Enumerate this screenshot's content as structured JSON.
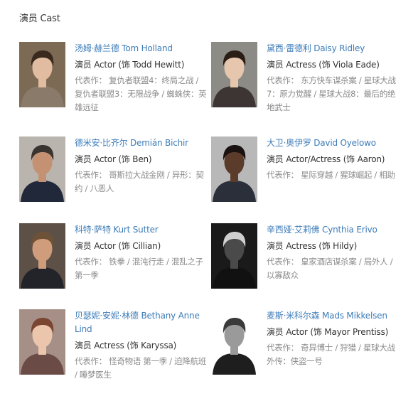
{
  "section": {
    "title": "演员 Cast"
  },
  "cast": [
    {
      "name": "汤姆·赫兰德 Tom Holland",
      "role": "演员 Actor (饰 Todd Hewitt)",
      "works_prefix": "代表作：",
      "works": "复仇者联盟4：终局之战 / 复仇者联盟3：无限战争 / 蜘蛛侠：英雄远征",
      "photo": {
        "bg": "#7d6a55",
        "skin": "#e2bca0",
        "hair": "#3a2a1e",
        "shirt": "#8a7a6a"
      }
    },
    {
      "name": "黛西·雷德利 Daisy Ridley",
      "role": "演员 Actress (饰 Viola Eade)",
      "works_prefix": "代表作：",
      "works": "东方快车谋杀案 / 星球大战7：原力觉醒 / 星球大战8：最后的绝地武士",
      "photo": {
        "bg": "#8c8b86",
        "skin": "#e6c6ad",
        "hair": "#2a1d16",
        "shirt": "#3c3533"
      }
    },
    {
      "name": "德米安·比齐尔 Demián Bichir",
      "role": "演员 Actor (饰 Ben)",
      "works_prefix": "代表作：",
      "works": "哥斯拉大战金刚 / 异形：契约 / 八恶人",
      "photo": {
        "bg": "#b9b4ad",
        "skin": "#c49272",
        "hair": "#3a3430",
        "shirt": "#20283a"
      }
    },
    {
      "name": "大卫·奥伊罗 David Oyelowo",
      "role": "演员 Actor/Actress (饰 Aaron)",
      "works_prefix": "代表作：",
      "works": "星际穿越 / 猩球崛起 / 相助",
      "photo": {
        "bg": "#b8b8b8",
        "skin": "#5b3b2a",
        "hair": "#1a1210",
        "shirt": "#2a2f3a"
      }
    },
    {
      "name": "科特·萨特 Kurt Sutter",
      "role": "演员 Actor (饰 Cillian)",
      "works_prefix": "代表作：",
      "works": "铁拳 / 混沌行走 / 混乱之子 第一季",
      "photo": {
        "bg": "#5d5046",
        "skin": "#cf9d7c",
        "hair": "#6e5238",
        "shirt": "#23242a"
      }
    },
    {
      "name": "辛西娅·艾莉佛 Cynthia Erivo",
      "role": "演员 Actress (饰 Hildy)",
      "works_prefix": "代表作：",
      "works": "皇家酒店谋杀案 / 局外人 / 以寡敌众",
      "photo": {
        "bg": "#1a1a1a",
        "skin": "#4a4a4a",
        "hair": "#cfcfcf",
        "shirt": "#111111"
      }
    },
    {
      "name": "贝瑟妮·安妮·林德 Bethany Anne Lind",
      "role": "演员 Actress (饰 Karyssa)",
      "works_prefix": "代表作：",
      "works": "怪奇物语 第一季 / 迫降航班 / 睡梦医生",
      "photo": {
        "bg": "#a58f86",
        "skin": "#ebc6ad",
        "hair": "#7a4632",
        "shirt": "#6a4b45"
      }
    },
    {
      "name": "麦斯·米科尔森 Mads Mikkelsen",
      "role": "演员 Actor (饰 Mayor Prentiss)",
      "works_prefix": "代表作：",
      "works": "奇异博士 / 狩猎 / 星球大战外传：侠盗一号",
      "photo": {
        "bg": "#ffffff",
        "skin": "#9a9a9a",
        "hair": "#3a3a3a",
        "shirt": "#1e1e1e"
      }
    }
  ]
}
